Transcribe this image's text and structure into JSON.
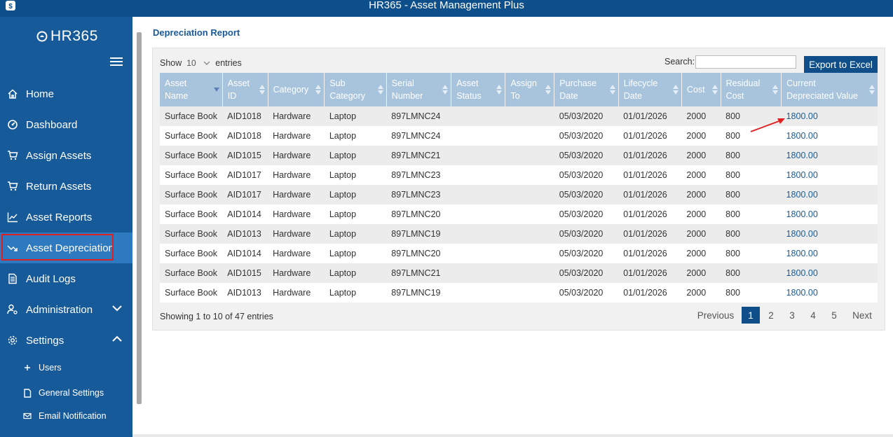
{
  "window": {
    "title": "HR365 - Asset Management Plus"
  },
  "sidebar": {
    "logo_text": "HR365",
    "items": [
      {
        "label": "Home",
        "icon": "home-icon"
      },
      {
        "label": "Dashboard",
        "icon": "dashboard-icon"
      },
      {
        "label": "Assign Assets",
        "icon": "cart-icon"
      },
      {
        "label": "Return Assets",
        "icon": "cart-icon"
      },
      {
        "label": "Asset Reports",
        "icon": "line-chart-icon"
      },
      {
        "label": "Asset Depreciation",
        "icon": "trend-down-icon",
        "active": true
      },
      {
        "label": "Audit Logs",
        "icon": "document-icon"
      },
      {
        "label": "Administration",
        "icon": "people-settings-icon",
        "expand": "chevron-down-icon"
      },
      {
        "label": "Settings",
        "icon": "gear-icon",
        "expand": "chevron-up-icon"
      }
    ],
    "sub_items": [
      {
        "label": "Users",
        "icon": "plus-icon"
      },
      {
        "label": "General Settings",
        "icon": "page-icon"
      },
      {
        "label": "Email Notification",
        "icon": "mail-icon"
      }
    ]
  },
  "main": {
    "page_title": "Depreciation Report",
    "show_label": "Show",
    "show_value": "10",
    "entries_label": "entries",
    "search_label": "Search:",
    "search_value": "",
    "export_label": "Export to Excel",
    "columns": [
      {
        "line1": "Asset Name",
        "line2": ""
      },
      {
        "line1": "Asset",
        "line2": "ID"
      },
      {
        "line1": "Category",
        "line2": ""
      },
      {
        "line1": "Sub",
        "line2": "Category"
      },
      {
        "line1": "Serial",
        "line2": "Number"
      },
      {
        "line1": "Asset",
        "line2": "Status"
      },
      {
        "line1": "Assign",
        "line2": "To"
      },
      {
        "line1": "Purchase",
        "line2": "Date"
      },
      {
        "line1": "Lifecycle",
        "line2": "Date"
      },
      {
        "line1": "Cost",
        "line2": ""
      },
      {
        "line1": "Residual",
        "line2": "Cost"
      },
      {
        "line1": "Current",
        "line2": "Depreciated Value"
      }
    ],
    "rows": [
      [
        "Surface Book",
        "AID1018",
        "Hardware",
        "Laptop",
        "897LMNC24",
        "",
        "",
        "05/03/2020",
        "01/01/2026",
        "2000",
        "800",
        "1800.00"
      ],
      [
        "Surface Book",
        "AID1018",
        "Hardware",
        "Laptop",
        "897LMNC24",
        "",
        "",
        "05/03/2020",
        "01/01/2026",
        "2000",
        "800",
        "1800.00"
      ],
      [
        "Surface Book",
        "AID1015",
        "Hardware",
        "Laptop",
        "897LMNC21",
        "",
        "",
        "05/03/2020",
        "01/01/2026",
        "2000",
        "800",
        "1800.00"
      ],
      [
        "Surface Book",
        "AID1017",
        "Hardware",
        "Laptop",
        "897LMNC23",
        "",
        "",
        "05/03/2020",
        "01/01/2026",
        "2000",
        "800",
        "1800.00"
      ],
      [
        "Surface Book",
        "AID1017",
        "Hardware",
        "Laptop",
        "897LMNC23",
        "",
        "",
        "05/03/2020",
        "01/01/2026",
        "2000",
        "800",
        "1800.00"
      ],
      [
        "Surface Book",
        "AID1014",
        "Hardware",
        "Laptop",
        "897LMNC20",
        "",
        "",
        "05/03/2020",
        "01/01/2026",
        "2000",
        "800",
        "1800.00"
      ],
      [
        "Surface Book",
        "AID1013",
        "Hardware",
        "Laptop",
        "897LMNC19",
        "",
        "",
        "05/03/2020",
        "01/01/2026",
        "2000",
        "800",
        "1800.00"
      ],
      [
        "Surface Book",
        "AID1014",
        "Hardware",
        "Laptop",
        "897LMNC20",
        "",
        "",
        "05/03/2020",
        "01/01/2026",
        "2000",
        "800",
        "1800.00"
      ],
      [
        "Surface Book",
        "AID1015",
        "Hardware",
        "Laptop",
        "897LMNC21",
        "",
        "",
        "05/03/2020",
        "01/01/2026",
        "2000",
        "800",
        "1800.00"
      ],
      [
        "Surface Book",
        "AID1013",
        "Hardware",
        "Laptop",
        "897LMNC19",
        "",
        "",
        "05/03/2020",
        "01/01/2026",
        "2000",
        "800",
        "1800.00"
      ]
    ],
    "info_text": "Showing 1 to 10 of 47 entries",
    "pagination": {
      "previous": "Previous",
      "pages": [
        "1",
        "2",
        "3",
        "4",
        "5"
      ],
      "current": "1",
      "next": "Next"
    }
  },
  "colors": {
    "title_bar": "#0d4f8b",
    "sidebar": "#175a99",
    "sidebar_active": "#2e7ac0",
    "header_cell": "#a8c4dd",
    "accent": "#0f4e88",
    "highlight_box": "#e02020"
  }
}
